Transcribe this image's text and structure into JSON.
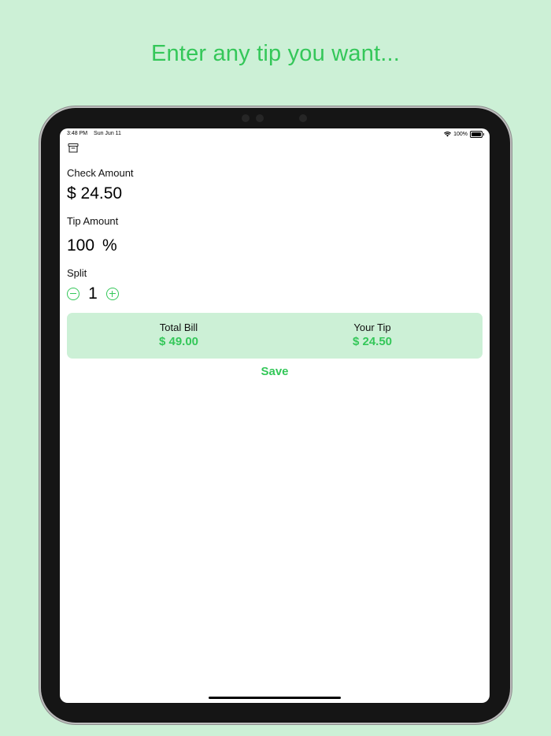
{
  "headline": "Enter any tip you want...",
  "status_bar": {
    "time": "3:48 PM",
    "date": "Sun Jun 11",
    "battery": "100%"
  },
  "icons": {
    "toolbar": "archive-box-icon",
    "wifi": "wifi-icon",
    "battery": "battery-icon",
    "decrement": "minus-circle-icon",
    "increment": "plus-circle-icon"
  },
  "form": {
    "check_label": "Check Amount",
    "check_value": "$ 24.50",
    "tip_label": "Tip Amount",
    "tip_value": "100",
    "tip_unit": "%",
    "split_label": "Split",
    "split_value": "1"
  },
  "summary": {
    "total_label": "Total Bill",
    "total_value": "$ 49.00",
    "tip_label": "Your Tip",
    "tip_value": "$ 24.50"
  },
  "save_label": "Save",
  "colors": {
    "accent": "#34c759",
    "background": "#ccf0d6",
    "summary_card": "#ccf0d6"
  }
}
